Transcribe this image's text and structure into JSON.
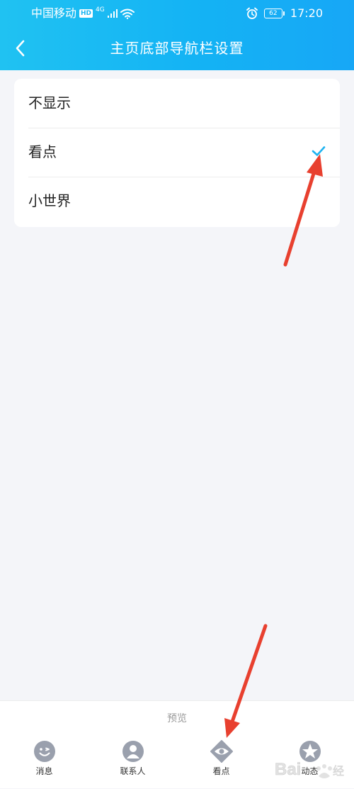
{
  "status_bar": {
    "carrier": "中国移动",
    "hd_badge": "HD",
    "network_type": "4G",
    "battery_level": "62",
    "time": "17:20"
  },
  "title_bar": {
    "title": "主页底部导航栏设置"
  },
  "options": [
    {
      "label": "不显示",
      "selected": false
    },
    {
      "label": "看点",
      "selected": true
    },
    {
      "label": "小世界",
      "selected": false
    }
  ],
  "preview": {
    "label": "预览",
    "tabs": [
      {
        "label": "消息",
        "icon": "message-icon"
      },
      {
        "label": "联系人",
        "icon": "contacts-icon"
      },
      {
        "label": "看点",
        "icon": "eye-icon"
      },
      {
        "label": "动态",
        "icon": "star-icon"
      }
    ]
  },
  "colors": {
    "header_start": "#20c2f2",
    "header_end": "#17a7f6",
    "check": "#1fb3f0",
    "tab_icon": "#9aa0ad",
    "annotation_arrow": "#e8402f"
  }
}
